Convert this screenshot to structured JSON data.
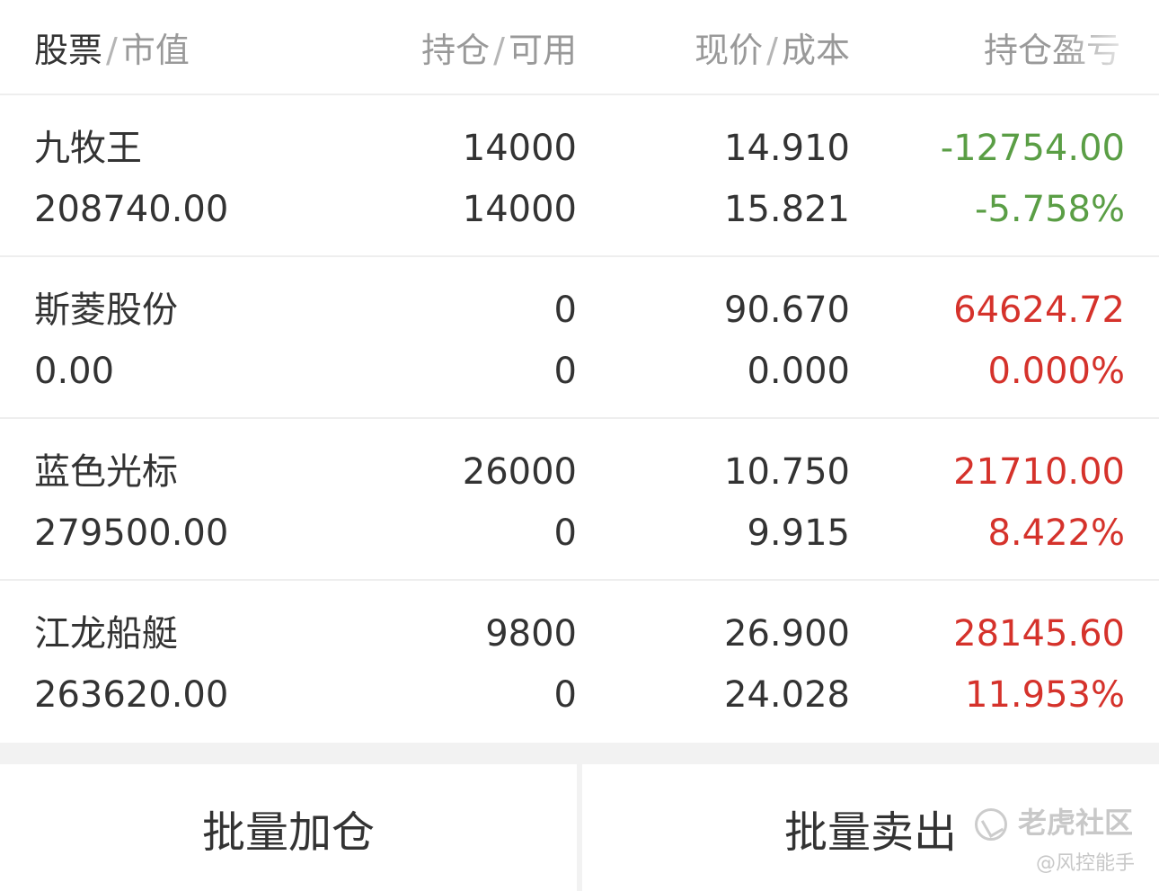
{
  "header": {
    "col1_main": "股票",
    "col1_sub": "市值",
    "col2_main": "持仓",
    "col2_sub": "可用",
    "col3_main": "现价",
    "col3_sub": "成本",
    "col4": "持仓盈亏",
    "separator": "/"
  },
  "rows": [
    {
      "name": "九牧王",
      "market_value": "208740.00",
      "position": "14000",
      "available": "14000",
      "price": "14.910",
      "cost": "15.821",
      "pl": "-12754.00",
      "pl_pct": "-5.758%",
      "trend": "down"
    },
    {
      "name": "斯菱股份",
      "market_value": "0.00",
      "position": "0",
      "available": "0",
      "price": "90.670",
      "cost": "0.000",
      "pl": "64624.72",
      "pl_pct": "0.000%",
      "trend": "up"
    },
    {
      "name": "蓝色光标",
      "market_value": "279500.00",
      "position": "26000",
      "available": "0",
      "price": "10.750",
      "cost": "9.915",
      "pl": "21710.00",
      "pl_pct": "8.422%",
      "trend": "up"
    },
    {
      "name": "江龙船艇",
      "market_value": "263620.00",
      "position": "9800",
      "available": "0",
      "price": "26.900",
      "cost": "24.028",
      "pl": "28145.60",
      "pl_pct": "11.953%",
      "trend": "up"
    }
  ],
  "footer": {
    "add_label": "批量加仓",
    "sell_label": "批量卖出"
  },
  "watermark": {
    "title": "老虎社区",
    "user": "@风控能手"
  },
  "colors": {
    "loss": "#5a9e45",
    "gain": "#d5322b"
  }
}
